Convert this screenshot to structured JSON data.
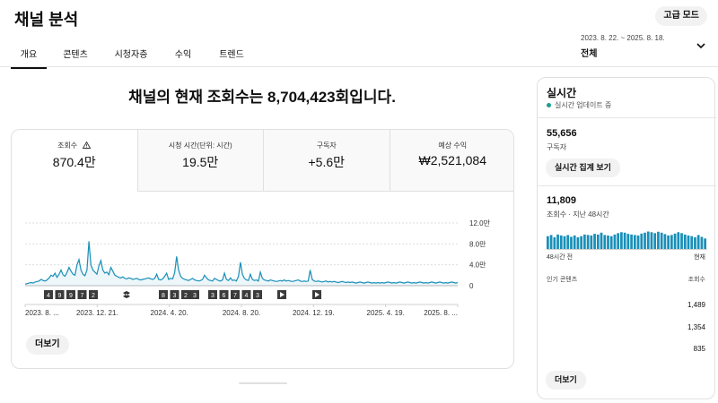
{
  "page": {
    "title": "채널 분석",
    "advanced_mode_label": "고급 모드"
  },
  "tabs": [
    {
      "label": "개요",
      "active": true
    },
    {
      "label": "콘텐츠",
      "active": false
    },
    {
      "label": "시청자층",
      "active": false
    },
    {
      "label": "수익",
      "active": false
    },
    {
      "label": "트렌드",
      "active": false
    }
  ],
  "date_filter": {
    "range": "2023. 8. 22. ~ 2025. 8. 18.",
    "value": "전체",
    "icon": "chevron-down-icon"
  },
  "headline": "채널의 현재 조회수는 8,704,423회입니다.",
  "metrics": [
    {
      "label": "조회수",
      "value": "870.4만",
      "selected": true,
      "icon": "warning-icon"
    },
    {
      "label": "시청 시간(단위: 시간)",
      "value": "19.5만",
      "selected": false
    },
    {
      "label": "구독자",
      "value": "+5.6만",
      "selected": false
    },
    {
      "label": "예상 수익",
      "value": "₩2,521,084",
      "selected": false
    }
  ],
  "more_label": "더보기",
  "colors": {
    "line": "#1a8fb8",
    "accent_dot": "#1e9e8e",
    "realtime_bar": "#1a8fb8",
    "grid": "#dddddd"
  },
  "chart_data": {
    "type": "line",
    "yticks": [
      "12.0만",
      "8.0만",
      "4.0만",
      "0"
    ],
    "ylim": [
      0,
      120000
    ],
    "xticks": [
      "2023. 8. ...",
      "2023. 12. 21.",
      "2024. 4. 20.",
      "2024. 8. 20.",
      "2024. 12. 19.",
      "2025. 4. 19.",
      "2025. 8. ..."
    ],
    "x_start": "2023-08-22",
    "x_end": "2025-08-18",
    "grid": true,
    "series": [
      {
        "values": [
          3000,
          4000,
          5000,
          6000,
          5000,
          7000,
          8000,
          9000,
          12000,
          10000,
          9000,
          11000,
          15000,
          20000,
          18000,
          24000,
          16000,
          22000,
          30000,
          21000,
          18000,
          25000,
          35000,
          28000,
          22000,
          20000,
          40000,
          50000,
          30000,
          22000,
          19000,
          30000,
          85000,
          40000,
          30000,
          26000,
          22000,
          38000,
          48000,
          30000,
          24000,
          26000,
          21000,
          35000,
          28000,
          20000,
          18000,
          16000,
          15000,
          17000,
          14000,
          13000,
          15000,
          14000,
          12000,
          13000,
          14000,
          12000,
          11000,
          12000,
          13000,
          14000,
          15000,
          13000,
          12000,
          14000,
          22000,
          12000,
          11000,
          13000,
          18000,
          24000,
          12000,
          14000,
          13000,
          25000,
          56000,
          30000,
          18000,
          14000,
          12000,
          11000,
          10000,
          12000,
          14000,
          11000,
          10000,
          9000,
          10000,
          12000,
          20000,
          15000,
          11000,
          10000,
          9000,
          14000,
          12000,
          10000,
          9000,
          11000,
          24000,
          12000,
          10000,
          15000,
          10000,
          11000,
          9000,
          18000,
          45000,
          22000,
          14000,
          11000,
          10000,
          22000,
          12000,
          10000,
          11000,
          9000,
          26000,
          14000,
          11000,
          10000,
          9000,
          11000,
          10000,
          9000,
          8000,
          9000,
          10000,
          9000,
          11000,
          9000,
          10000,
          9000,
          8000,
          9000,
          10000,
          11000,
          9000,
          8000,
          9000,
          8000,
          9000,
          30000,
          12000,
          9000,
          8000,
          9000,
          8000,
          7000,
          8000,
          9000,
          7000,
          8000,
          7000,
          8000,
          7000,
          6000,
          7000,
          8000,
          7000,
          6000,
          7000,
          6000,
          7000,
          6000,
          5000,
          6000,
          7000,
          6000,
          5000,
          6000,
          7000,
          6000,
          5000,
          6000,
          5000,
          6000,
          5000,
          6000,
          5000,
          6000,
          7000,
          6000,
          5000,
          6000,
          5000,
          6000,
          7000,
          6000,
          5000,
          6000,
          7000,
          6000,
          5000,
          6000,
          5000,
          6000,
          7000,
          6000,
          5000,
          6000,
          5000,
          6000,
          7000,
          6000,
          5000,
          6000,
          7000,
          6000,
          5000,
          6000,
          5000,
          6000,
          7000,
          6000,
          5000,
          6000
        ]
      }
    ]
  },
  "video_markers": {
    "icons": [
      "numbered-marker",
      "play-marker",
      "split-marker"
    ],
    "groups": [
      {
        "labels": [
          "4",
          "9",
          "9",
          "7",
          "2"
        ]
      },
      {
        "labels": [
          "split"
        ]
      },
      {
        "labels": [
          "8",
          "3",
          "2"
        ]
      },
      {
        "labels": [
          "3"
        ]
      },
      {
        "labels": [
          "3",
          "6",
          "7",
          "4",
          "3"
        ]
      },
      {
        "labels": [
          "play"
        ]
      },
      {
        "labels": [
          "play"
        ]
      }
    ]
  },
  "realtime": {
    "title": "실시간",
    "status": "실시간 업데이트 중",
    "subscribers_value": "55,656",
    "subscribers_label": "구독자",
    "view_realtime_label": "실시간 집계 보기",
    "views_value": "11,809",
    "views_label": "조회수 · 지난 48시간",
    "axis_start": "48시간 전",
    "axis_end": "현재",
    "bars": [
      0.55,
      0.6,
      0.5,
      0.62,
      0.58,
      0.55,
      0.6,
      0.52,
      0.58,
      0.5,
      0.55,
      0.62,
      0.6,
      0.58,
      0.65,
      0.62,
      0.7,
      0.6,
      0.58,
      0.55,
      0.62,
      0.68,
      0.72,
      0.7,
      0.65,
      0.62,
      0.6,
      0.58,
      0.66,
      0.7,
      0.75,
      0.72,
      0.68,
      0.74,
      0.7,
      0.64,
      0.58,
      0.6,
      0.66,
      0.72,
      0.68,
      0.62,
      0.58,
      0.55,
      0.5,
      0.6,
      0.52,
      0.45
    ],
    "table_header_left": "인기 콘텐츠",
    "table_header_right": "조회수",
    "rows": [
      {
        "views": "1,489"
      },
      {
        "views": "1,354"
      },
      {
        "views": "835"
      }
    ],
    "more_label": "더보기"
  }
}
